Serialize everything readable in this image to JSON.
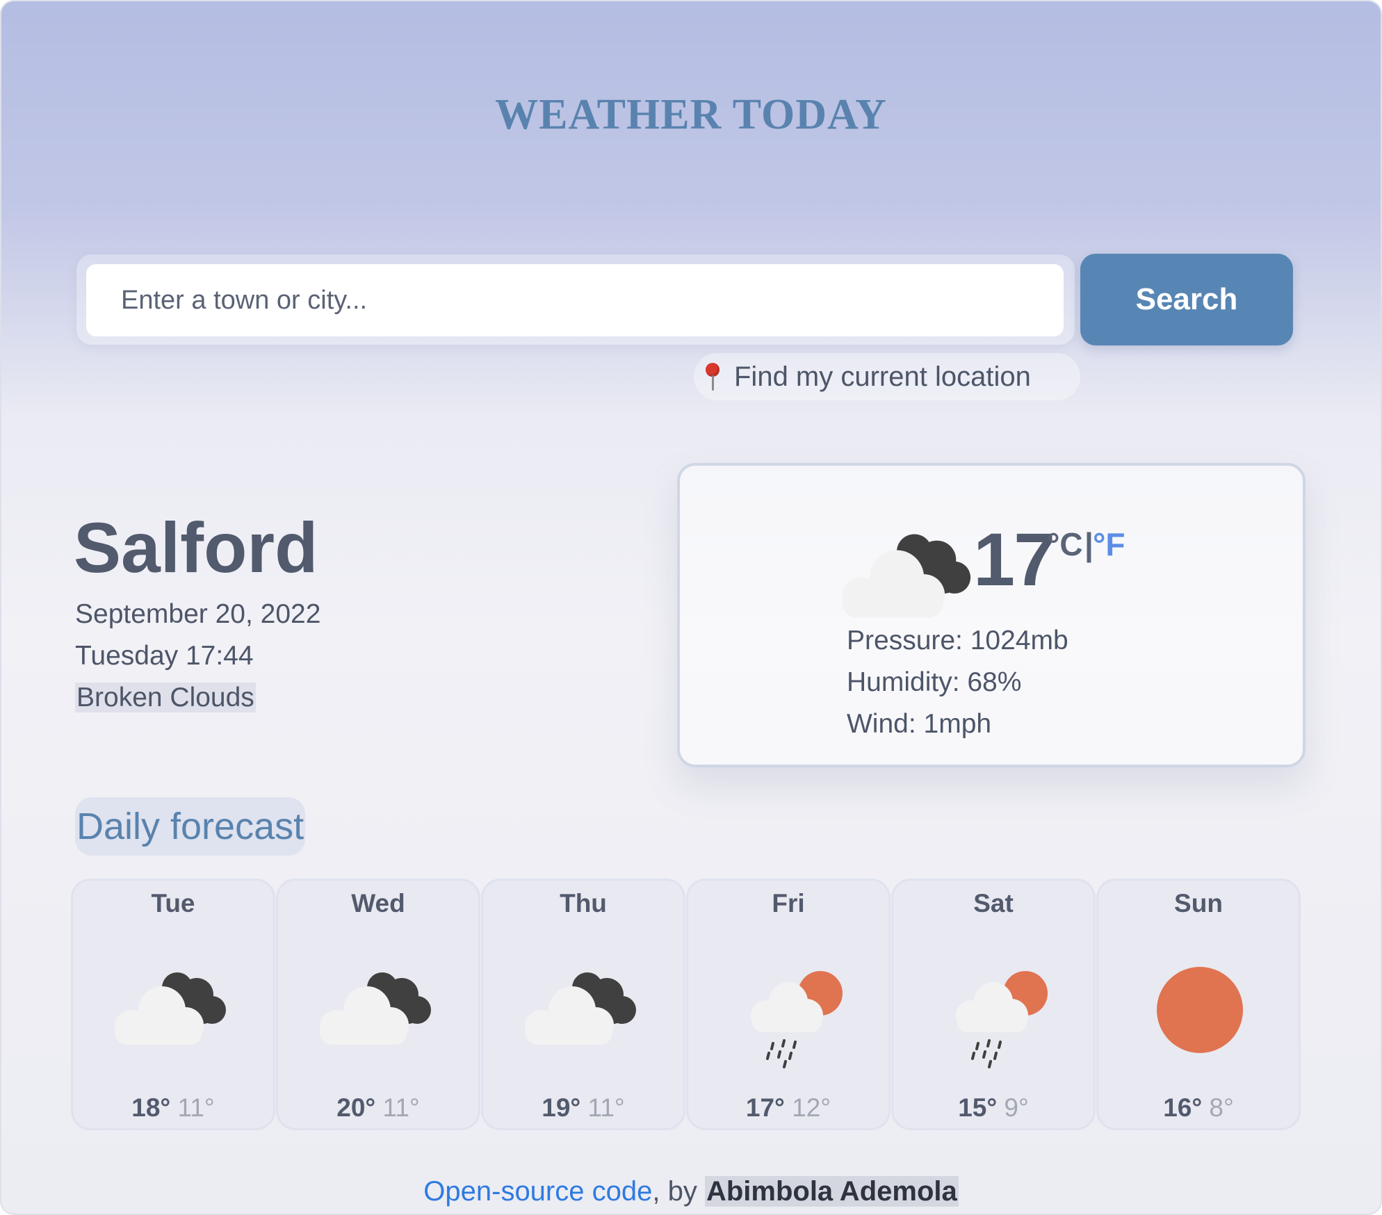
{
  "header": {
    "title": "WEATHER TODAY"
  },
  "search": {
    "placeholder": "Enter a town or city...",
    "value": "",
    "button_label": "Search",
    "location_label": "Find my current location",
    "location_icon": "pin-icon"
  },
  "current": {
    "city": "Salford",
    "date": "September 20, 2022",
    "day_time": "Tuesday 17:44",
    "description": "Broken Clouds",
    "icon": "broken-clouds-icon",
    "temperature": "17",
    "unit_c": "°C",
    "unit_separator": "|",
    "unit_f": "°F",
    "pressure": "Pressure: 1024mb",
    "humidity": "Humidity: 68%",
    "wind": "Wind: 1mph"
  },
  "forecast": {
    "title": "Daily forecast",
    "days": [
      {
        "day": "Tue",
        "icon": "broken-clouds-icon",
        "max": "18°",
        "min": "11°"
      },
      {
        "day": "Wed",
        "icon": "broken-clouds-icon",
        "max": "20°",
        "min": "11°"
      },
      {
        "day": "Thu",
        "icon": "broken-clouds-icon",
        "max": "19°",
        "min": "11°"
      },
      {
        "day": "Fri",
        "icon": "sun-rain-icon",
        "max": "17°",
        "min": "12°"
      },
      {
        "day": "Sat",
        "icon": "sun-rain-icon",
        "max": "15°",
        "min": "9°"
      },
      {
        "day": "Sun",
        "icon": "clear-sun-icon",
        "max": "16°",
        "min": "8°"
      }
    ]
  },
  "footer": {
    "link_text": "Open-source code",
    "separator": ", by ",
    "author": "Abimbola Ademola"
  },
  "colors": {
    "accent": "#5886b4",
    "title": "#5983ae",
    "link": "#2e7be0",
    "sun": "#e07350",
    "dark_cloud": "#404040",
    "light_cloud": "#f2f2f2"
  }
}
